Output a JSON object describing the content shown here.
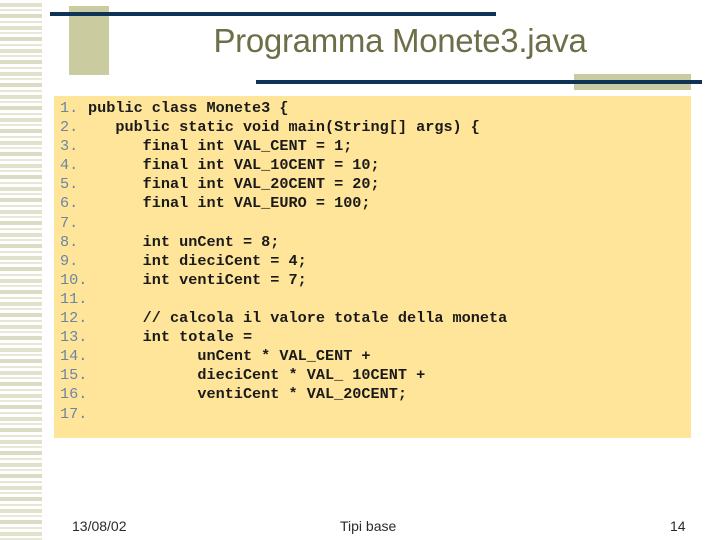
{
  "slide": {
    "title": "Programma Monete3.java",
    "code": [
      {
        "num": "1.",
        "text": "public class Monete3 {"
      },
      {
        "num": "2.",
        "text": "   public static void main(String[] args) {"
      },
      {
        "num": "3.",
        "text": "      final int VAL_CENT = 1;"
      },
      {
        "num": "4.",
        "text": "      final int VAL_10CENT = 10;"
      },
      {
        "num": "5.",
        "text": "      final int VAL_20CENT = 20;"
      },
      {
        "num": "6.",
        "text": "      final int VAL_EURO = 100;"
      },
      {
        "num": "7.",
        "text": ""
      },
      {
        "num": "8.",
        "text": "      int unCent = 8;"
      },
      {
        "num": "9.",
        "text": "      int dieciCent = 4;"
      },
      {
        "num": "10.",
        "text": "      int ventiCent = 7;"
      },
      {
        "num": "11.",
        "text": ""
      },
      {
        "num": "12.",
        "text": "      // calcola il valore totale della moneta"
      },
      {
        "num": "13.",
        "text": "      int totale ="
      },
      {
        "num": "14.",
        "text": "            unCent * VAL_CENT +"
      },
      {
        "num": "15.",
        "text": "            dieciCent * VAL_ 10CENT +"
      },
      {
        "num": "16.",
        "text": "            ventiCent * VAL_20CENT;"
      },
      {
        "num": "17.",
        "text": ""
      }
    ],
    "footer": {
      "date": "13/08/02",
      "center": "Tipi base",
      "page": "14"
    }
  }
}
